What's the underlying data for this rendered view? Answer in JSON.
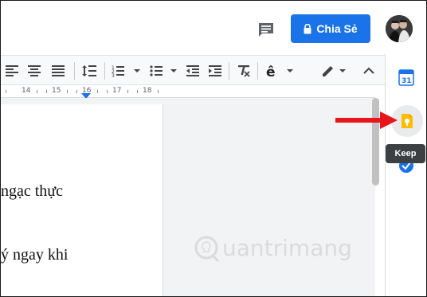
{
  "header": {
    "share_label": "Chia Sẻ"
  },
  "ruler": {
    "labels": [
      "14",
      "15",
      "16",
      "17",
      "18"
    ]
  },
  "document": {
    "lines": [
      "ngạc thực",
      "ý ngay khi"
    ]
  },
  "side_panel": {
    "calendar_day": "31",
    "tooltip": "Keep"
  },
  "watermark": {
    "text": "uantrimang"
  },
  "colors": {
    "accent": "#1a73e8",
    "arrow": "#e8161b",
    "keep_yellow": "#fbbc04"
  },
  "icons": [
    "comment-icon",
    "lock-icon",
    "align-left-icon",
    "align-center-icon",
    "align-right-icon",
    "align-justify-icon",
    "line-spacing-icon",
    "numbered-list-icon",
    "bulleted-list-icon",
    "decrease-indent-icon",
    "increase-indent-icon",
    "clear-formatting-icon",
    "input-tools-icon",
    "edit-mode-icon",
    "collapse-icon",
    "calendar-icon",
    "keep-icon",
    "tasks-icon"
  ]
}
